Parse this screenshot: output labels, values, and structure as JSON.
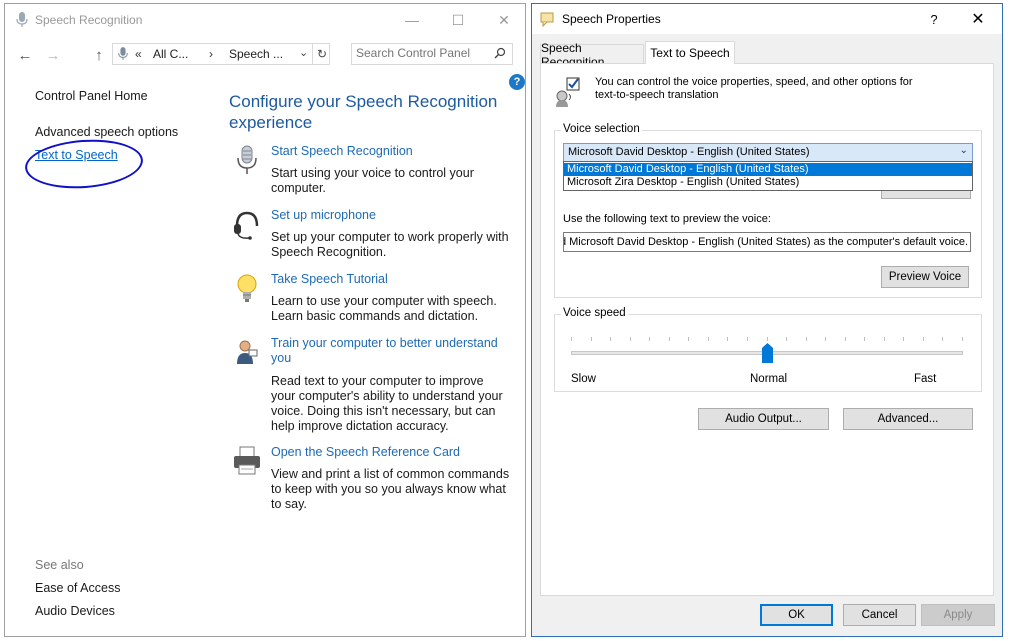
{
  "control_panel": {
    "title": "Speech Recognition",
    "address": {
      "part1": "All C...",
      "part2": "Speech ..."
    },
    "search_placeholder": "Search Control Panel",
    "left_nav": {
      "home": "Control Panel Home",
      "advanced": "Advanced speech options",
      "tts": "Text to Speech"
    },
    "see_also": {
      "heading": "See also",
      "items": [
        "Ease of Access",
        "Audio Devices"
      ]
    },
    "heading": "Configure your Speech Recognition experience",
    "tasks": [
      {
        "icon": "microphone-icon",
        "link": "Start Speech Recognition",
        "desc": "Start using your voice to control your computer."
      },
      {
        "icon": "headset-icon",
        "link": "Set up microphone",
        "desc": "Set up your computer to work properly with Speech Recognition."
      },
      {
        "icon": "lightbulb-icon",
        "link": "Take Speech Tutorial",
        "desc": "Learn to use your computer with speech. Learn basic commands and dictation."
      },
      {
        "icon": "user-training-icon",
        "link": "Train your computer to better understand you",
        "desc": "Read text to your computer to improve your computer's ability to understand your voice.  Doing this isn't necessary, but can help improve dictation accuracy."
      },
      {
        "icon": "printer-icon",
        "link": "Open the Speech Reference Card",
        "desc": "View and print a list of common commands to keep with you so you always know what to say."
      }
    ]
  },
  "speech_properties": {
    "title": "Speech Properties",
    "help": "?",
    "tabs": [
      "Speech Recognition",
      "Text to Speech"
    ],
    "active_tab": "Text to Speech",
    "info": "You can control the voice properties, speed, and other options for text-to-speech translation",
    "voice_selection": {
      "label": "Voice selection",
      "selected": "Microsoft David Desktop - English (United States)",
      "options": [
        "Microsoft David Desktop - English (United States)",
        "Microsoft Zira Desktop - English (United States)"
      ],
      "preview_label": "Use the following text to preview the voice:",
      "preview_text": "ted Microsoft David Desktop - English (United States) as the computer's default voice.",
      "preview_button": "Preview Voice"
    },
    "voice_speed": {
      "label": "Voice speed",
      "slow": "Slow",
      "normal": "Normal",
      "fast": "Fast",
      "value": 0.5
    },
    "buttons": {
      "audio_output": "Audio Output...",
      "advanced": "Advanced...",
      "ok": "OK",
      "cancel": "Cancel",
      "apply": "Apply"
    },
    "accent_color": "#0078d7"
  }
}
